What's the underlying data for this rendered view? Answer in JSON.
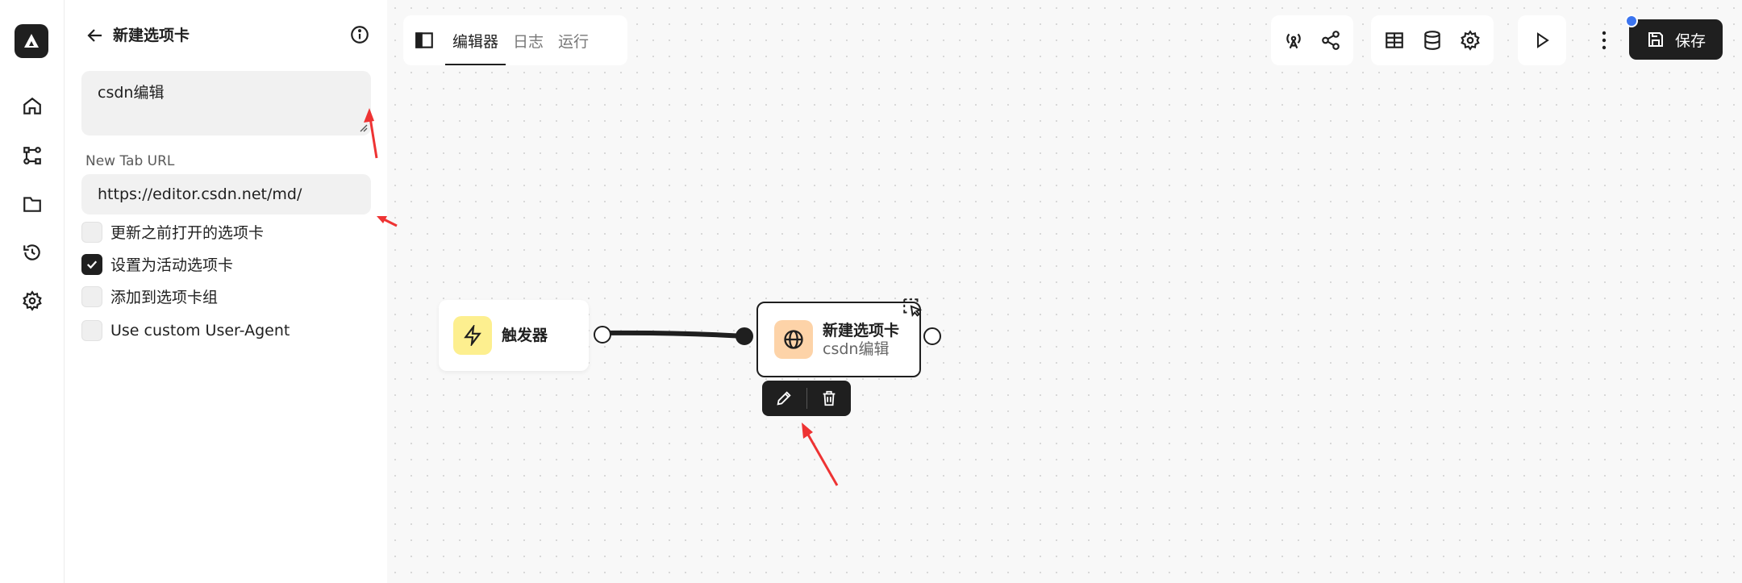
{
  "panel": {
    "title": "新建选项卡",
    "description_value": "csdn编辑",
    "url_label": "New Tab URL",
    "url_value": "https://editor.csdn.net/md/",
    "options": [
      {
        "label": "更新之前打开的选项卡",
        "checked": false
      },
      {
        "label": "设置为活动选项卡",
        "checked": true
      },
      {
        "label": "添加到选项卡组",
        "checked": false
      },
      {
        "label": "Use custom User-Agent",
        "checked": false
      }
    ]
  },
  "tabs": [
    {
      "label": "编辑器",
      "active": true
    },
    {
      "label": "日志",
      "active": false
    },
    {
      "label": "运行",
      "active": false
    }
  ],
  "toolbar": {
    "save_label": "保存"
  },
  "nodes": {
    "trigger": {
      "title": "触发器"
    },
    "new_tab": {
      "title": "新建选项卡",
      "subtitle": "csdn编辑"
    }
  },
  "colors": {
    "accent": "#1f1f1f",
    "trigger_icon_bg": "#fdef8f",
    "tab_icon_bg": "#fdd3a8",
    "annotation_arrow": "#ee3333",
    "badge": "#3b74ef"
  },
  "icons": {
    "rail": [
      "home-icon",
      "workflow-icon",
      "folder-icon",
      "history-icon",
      "settings-icon"
    ],
    "toolbar": [
      "broadcast-icon",
      "share-icon",
      "table-icon",
      "database-icon",
      "gear-icon",
      "play-icon",
      "more-vertical-icon",
      "save-icon"
    ]
  }
}
